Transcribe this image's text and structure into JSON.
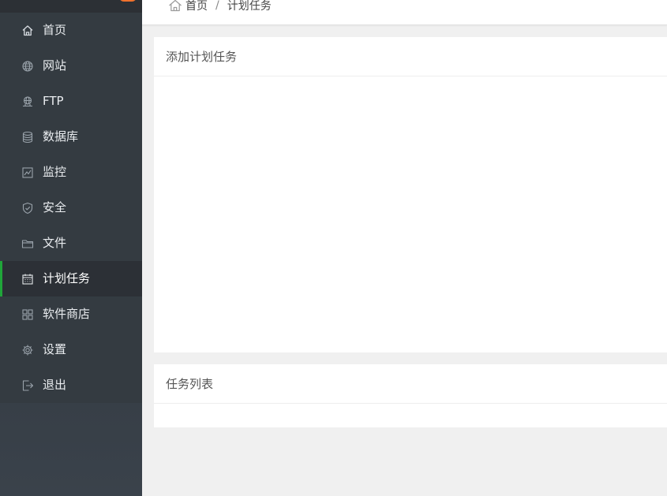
{
  "breadcrumb": {
    "home": "首页",
    "separator": "/",
    "current": "计划任务"
  },
  "sidebar": {
    "items": [
      {
        "label": "首页",
        "icon": "home-icon",
        "active": false
      },
      {
        "label": "网站",
        "icon": "globe-icon",
        "active": false
      },
      {
        "label": "FTP",
        "icon": "ftp-icon",
        "active": false
      },
      {
        "label": "数据库",
        "icon": "database-icon",
        "active": false
      },
      {
        "label": "监控",
        "icon": "monitor-icon",
        "active": false
      },
      {
        "label": "安全",
        "icon": "shield-icon",
        "active": false
      },
      {
        "label": "文件",
        "icon": "folder-icon",
        "active": false
      },
      {
        "label": "计划任务",
        "icon": "calendar-icon",
        "active": true
      },
      {
        "label": "软件商店",
        "icon": "grid-icon",
        "active": false
      },
      {
        "label": "设置",
        "icon": "gear-icon",
        "active": false
      },
      {
        "label": "退出",
        "icon": "logout-icon",
        "active": false
      }
    ]
  },
  "main": {
    "add_task_title": "添加计划任务",
    "task_list_title": "任务列表"
  },
  "colors": {
    "accent": "#20a53a",
    "badge": "#f0712c",
    "sidebar_bg": "#343b41"
  }
}
